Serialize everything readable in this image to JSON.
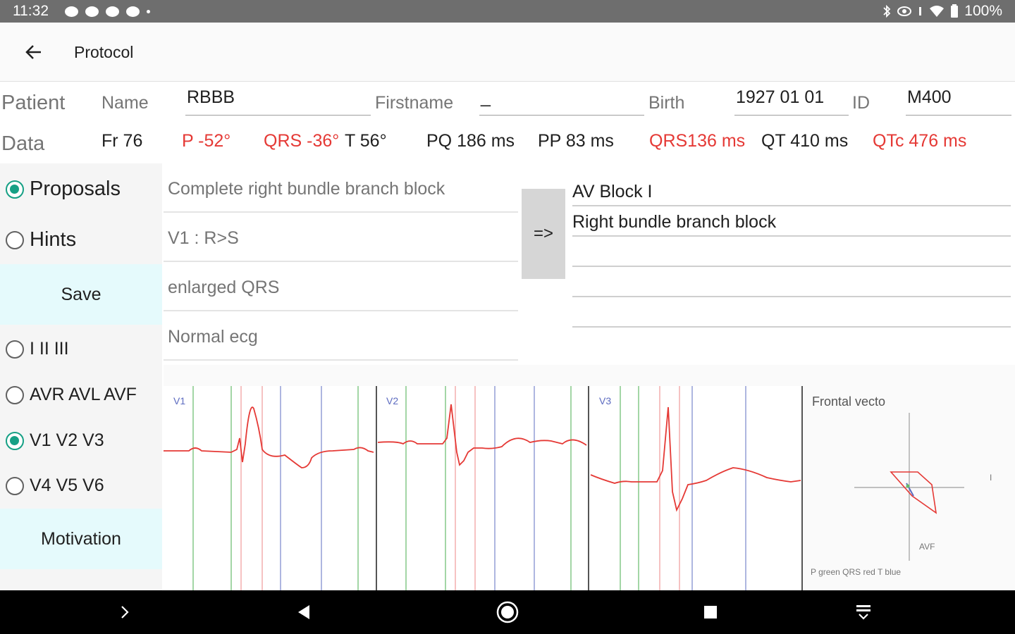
{
  "status_bar": {
    "time": "11:32",
    "battery": "100%"
  },
  "app_bar": {
    "title": "Protocol"
  },
  "patient": {
    "row_label": "Patient",
    "name_label": "Name",
    "name_value": "RBBB",
    "firstname_label": "Firstname",
    "firstname_value": "_",
    "birth_label": "Birth",
    "birth_value": "1927 01 01",
    "id_label": "ID",
    "id_value": "M400"
  },
  "data_row": {
    "row_label": "Data",
    "measurements": [
      {
        "text": "Fr 76",
        "abnormal": false
      },
      {
        "text": "P -52°",
        "abnormal": true
      },
      {
        "text": "QRS -36°",
        "abnormal": true
      },
      {
        "text": "T 56°",
        "abnormal": false
      },
      {
        "text": "PQ 186 ms",
        "abnormal": false
      },
      {
        "text": "PP 83 ms",
        "abnormal": false
      },
      {
        "text": "QRS136 ms",
        "abnormal": true
      },
      {
        "text": "QT 410 ms",
        "abnormal": false
      },
      {
        "text": "QTc 476 ms",
        "abnormal": true
      }
    ]
  },
  "mode": {
    "options": [
      {
        "label": "Proposals",
        "checked": true
      },
      {
        "label": "Hints",
        "checked": false
      }
    ],
    "save_label": "Save"
  },
  "leads": {
    "options": [
      {
        "label": "I II III",
        "checked": false
      },
      {
        "label": "AVR AVL AVF",
        "checked": false
      },
      {
        "label": "V1 V2 V3",
        "checked": true
      },
      {
        "label": "V4 V5 V6",
        "checked": false
      }
    ],
    "motivation_label": "Motivation"
  },
  "proposals": [
    "Complete right bundle branch block",
    "V1 : R>S",
    "enlarged QRS",
    "Normal ecg"
  ],
  "move_button_label": "=>",
  "selected": [
    "AV Block I",
    "Right bundle branch block",
    "",
    "",
    ""
  ],
  "ecg": {
    "lead_labels": [
      "V1",
      "V2",
      "V3"
    ],
    "vecto": {
      "title": "Frontal vecto",
      "axis_label": "AVF",
      "side_mark": "I",
      "legend": "P green  QRS red  T blue"
    }
  },
  "colors": {
    "accent": "#16a085",
    "abnormal": "#e53935",
    "trace": "#e53935",
    "p_marker": "#66bb6a",
    "qrs_marker": "#ef9a9a",
    "t_marker": "#7986cb",
    "button_bg": "#e5fafc"
  }
}
